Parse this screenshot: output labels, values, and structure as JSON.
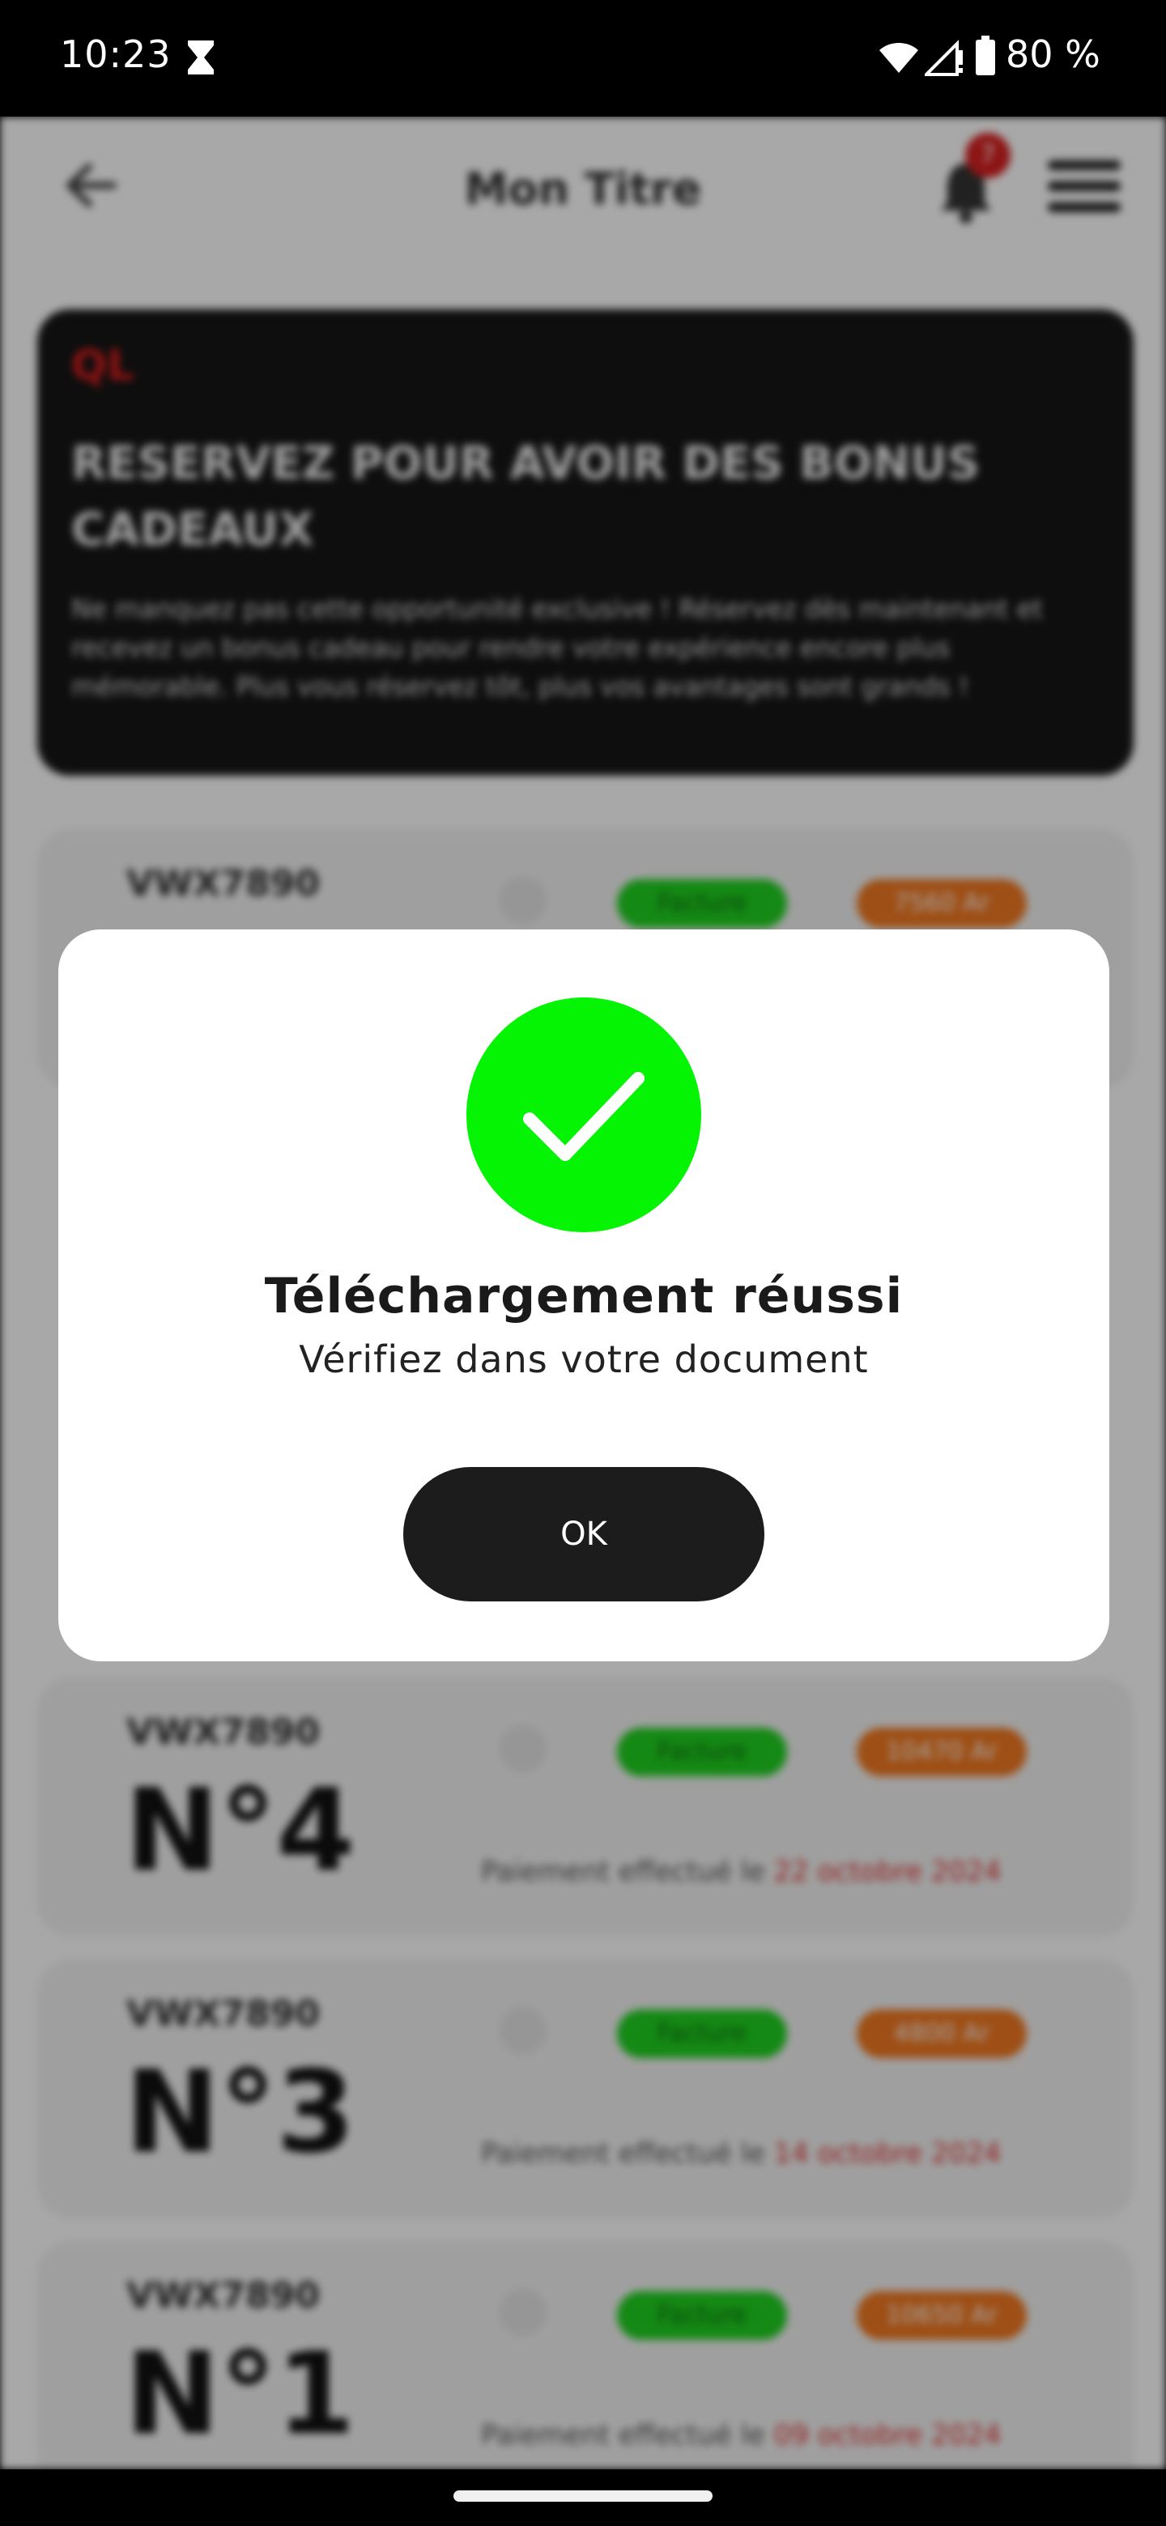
{
  "status_bar": {
    "time": "10:23",
    "battery": "80 %",
    "icons": [
      "hourglass-icon",
      "wifi-icon",
      "signal-icon",
      "battery-icon"
    ]
  },
  "header": {
    "title": "Mon Titre",
    "notification_count": "7",
    "icons": [
      "back-arrow-icon",
      "bell-icon",
      "menu-icon"
    ]
  },
  "promo": {
    "logo": "QL",
    "title": "RESERVEZ POUR AVOIR DES BONUS CADEAUX",
    "text": "Ne manquez pas cette opportunité exclusive ! Réservez dès maintenant et recevez un bonus cadeau pour rendre votre expérience encore plus mémorable. Plus vous réservez tôt, plus vos avantages sont grands !"
  },
  "tickets": [
    {
      "code": "VWX7890",
      "number": "",
      "badge": "Facture",
      "amount": "7560 Ar",
      "paid_prefix": "",
      "paid_date": ""
    },
    {
      "code": "VWX7890",
      "number": "N°4",
      "badge": "Facture",
      "amount": "10470 Ar",
      "paid_prefix": "Paiement effectué le ",
      "paid_date": "22 octobre 2024"
    },
    {
      "code": "VWX7890",
      "number": "N°3",
      "badge": "Facture",
      "amount": "4800 Ar",
      "paid_prefix": "Paiement effectué le ",
      "paid_date": "14 octobre 2024"
    },
    {
      "code": "VWX7890",
      "number": "N°1",
      "badge": "Facture",
      "amount": "10650 Ar",
      "paid_prefix": "Paiement effectué le ",
      "paid_date": "09 octobre 2024"
    }
  ],
  "modal": {
    "title": "Téléchargement réussi",
    "subtitle": "Vérifiez dans votre document",
    "ok_label": "OK",
    "success_color": "#04f404"
  },
  "colors": {
    "accent": "#1c1c1c",
    "success": "#04f404",
    "invoice_badge": "#1fd01f",
    "amount_badge": "#f07820",
    "date_highlight": "#e03030"
  }
}
